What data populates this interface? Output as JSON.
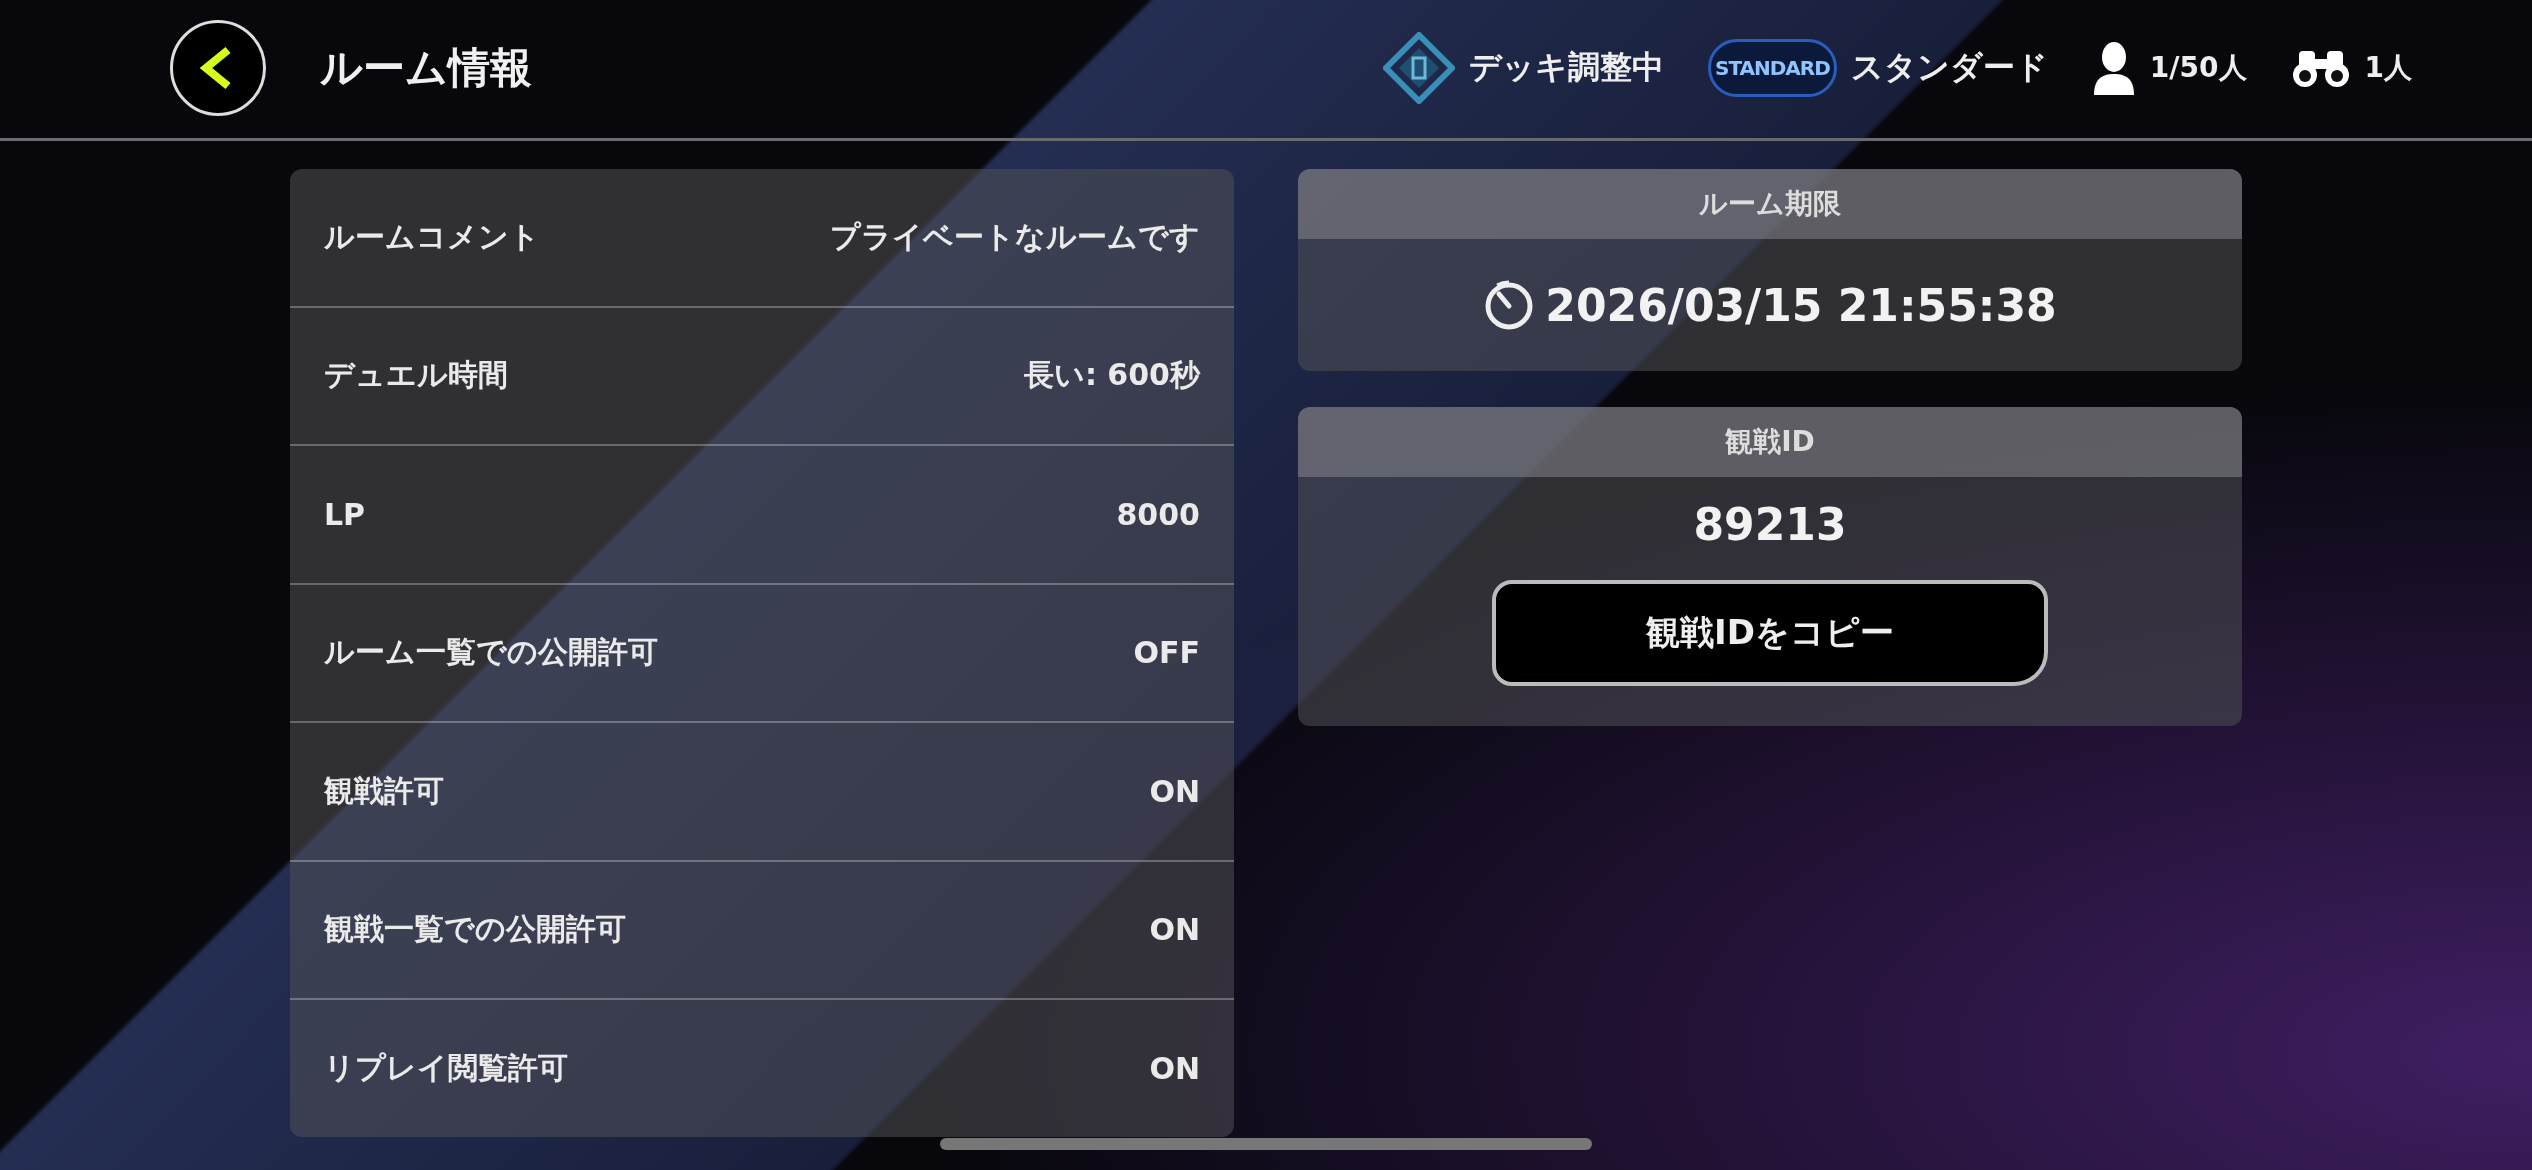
{
  "header": {
    "title": "ルーム情報",
    "status": "デッキ調整中",
    "format_badge": "STANDARD",
    "format": "スタンダード",
    "players": "1/50人",
    "spectators": "1人"
  },
  "settings": [
    {
      "label": "ルームコメント",
      "value": "プライベートなルームです"
    },
    {
      "label": "デュエル時間",
      "value": "長い: 600秒"
    },
    {
      "label": "LP",
      "value": "8000"
    },
    {
      "label": "ルーム一覧での公開許可",
      "value": "OFF"
    },
    {
      "label": "観戦許可",
      "value": "ON"
    },
    {
      "label": "観戦一覧での公開許可",
      "value": "ON"
    },
    {
      "label": "リプレイ閲覧許可",
      "value": "ON"
    }
  ],
  "expiry": {
    "title": "ルーム期限",
    "value": "2026/03/15 21:55:38"
  },
  "spectate": {
    "title": "観戦ID",
    "id": "89213",
    "button": "観戦IDをコピー"
  }
}
